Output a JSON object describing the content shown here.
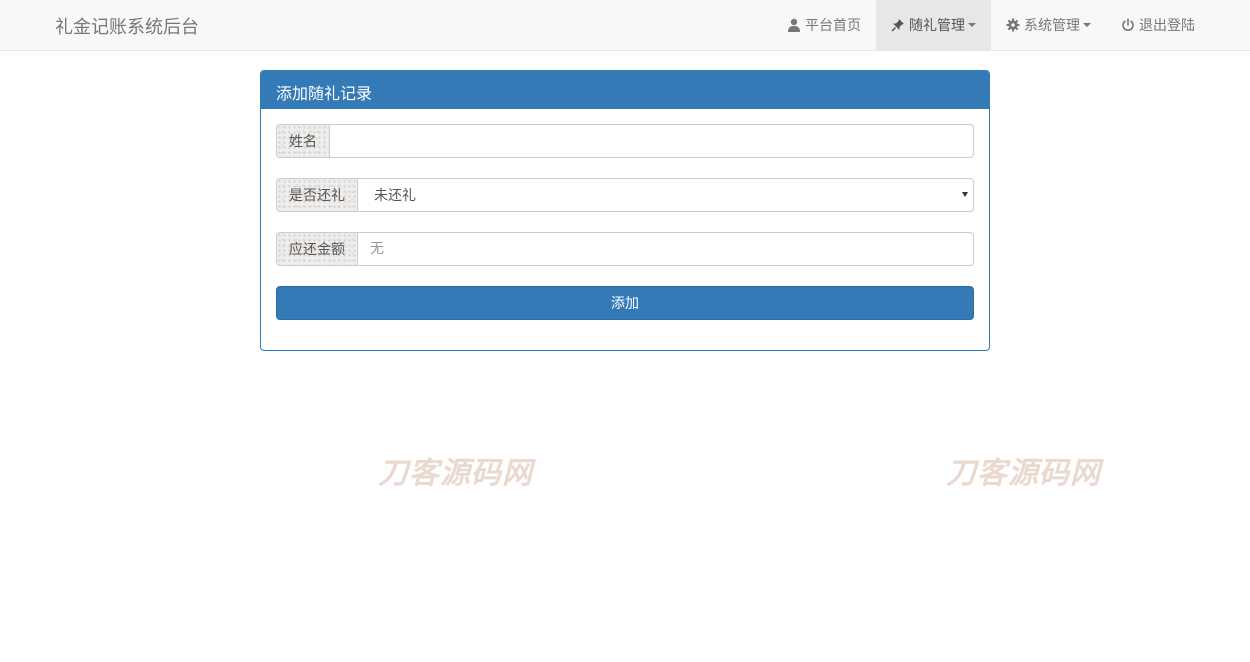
{
  "navbar": {
    "brand": "礼金记账系统后台",
    "items": [
      {
        "label": "平台首页",
        "icon": "user-icon",
        "caret": false,
        "active": false
      },
      {
        "label": "随礼管理",
        "icon": "pushpin-icon",
        "caret": true,
        "active": true
      },
      {
        "label": "系统管理",
        "icon": "gear-icon",
        "caret": true,
        "active": false
      },
      {
        "label": "退出登陆",
        "icon": "power-icon",
        "caret": false,
        "active": false
      }
    ]
  },
  "panel": {
    "title": "添加随礼记录",
    "name_field": {
      "label": "姓名",
      "value": "",
      "placeholder": ""
    },
    "returned_field": {
      "label": "是否还礼",
      "selected": "未还礼"
    },
    "amount_field": {
      "label": "应还金额",
      "value": "",
      "placeholder": "无"
    },
    "submit_label": "添加"
  },
  "watermarks": [
    "刀客源码网",
    "刀客源码网"
  ],
  "colors": {
    "primary": "#337ab7",
    "navbar_bg": "#f8f8f8",
    "active_bg": "#e7e7e7"
  }
}
